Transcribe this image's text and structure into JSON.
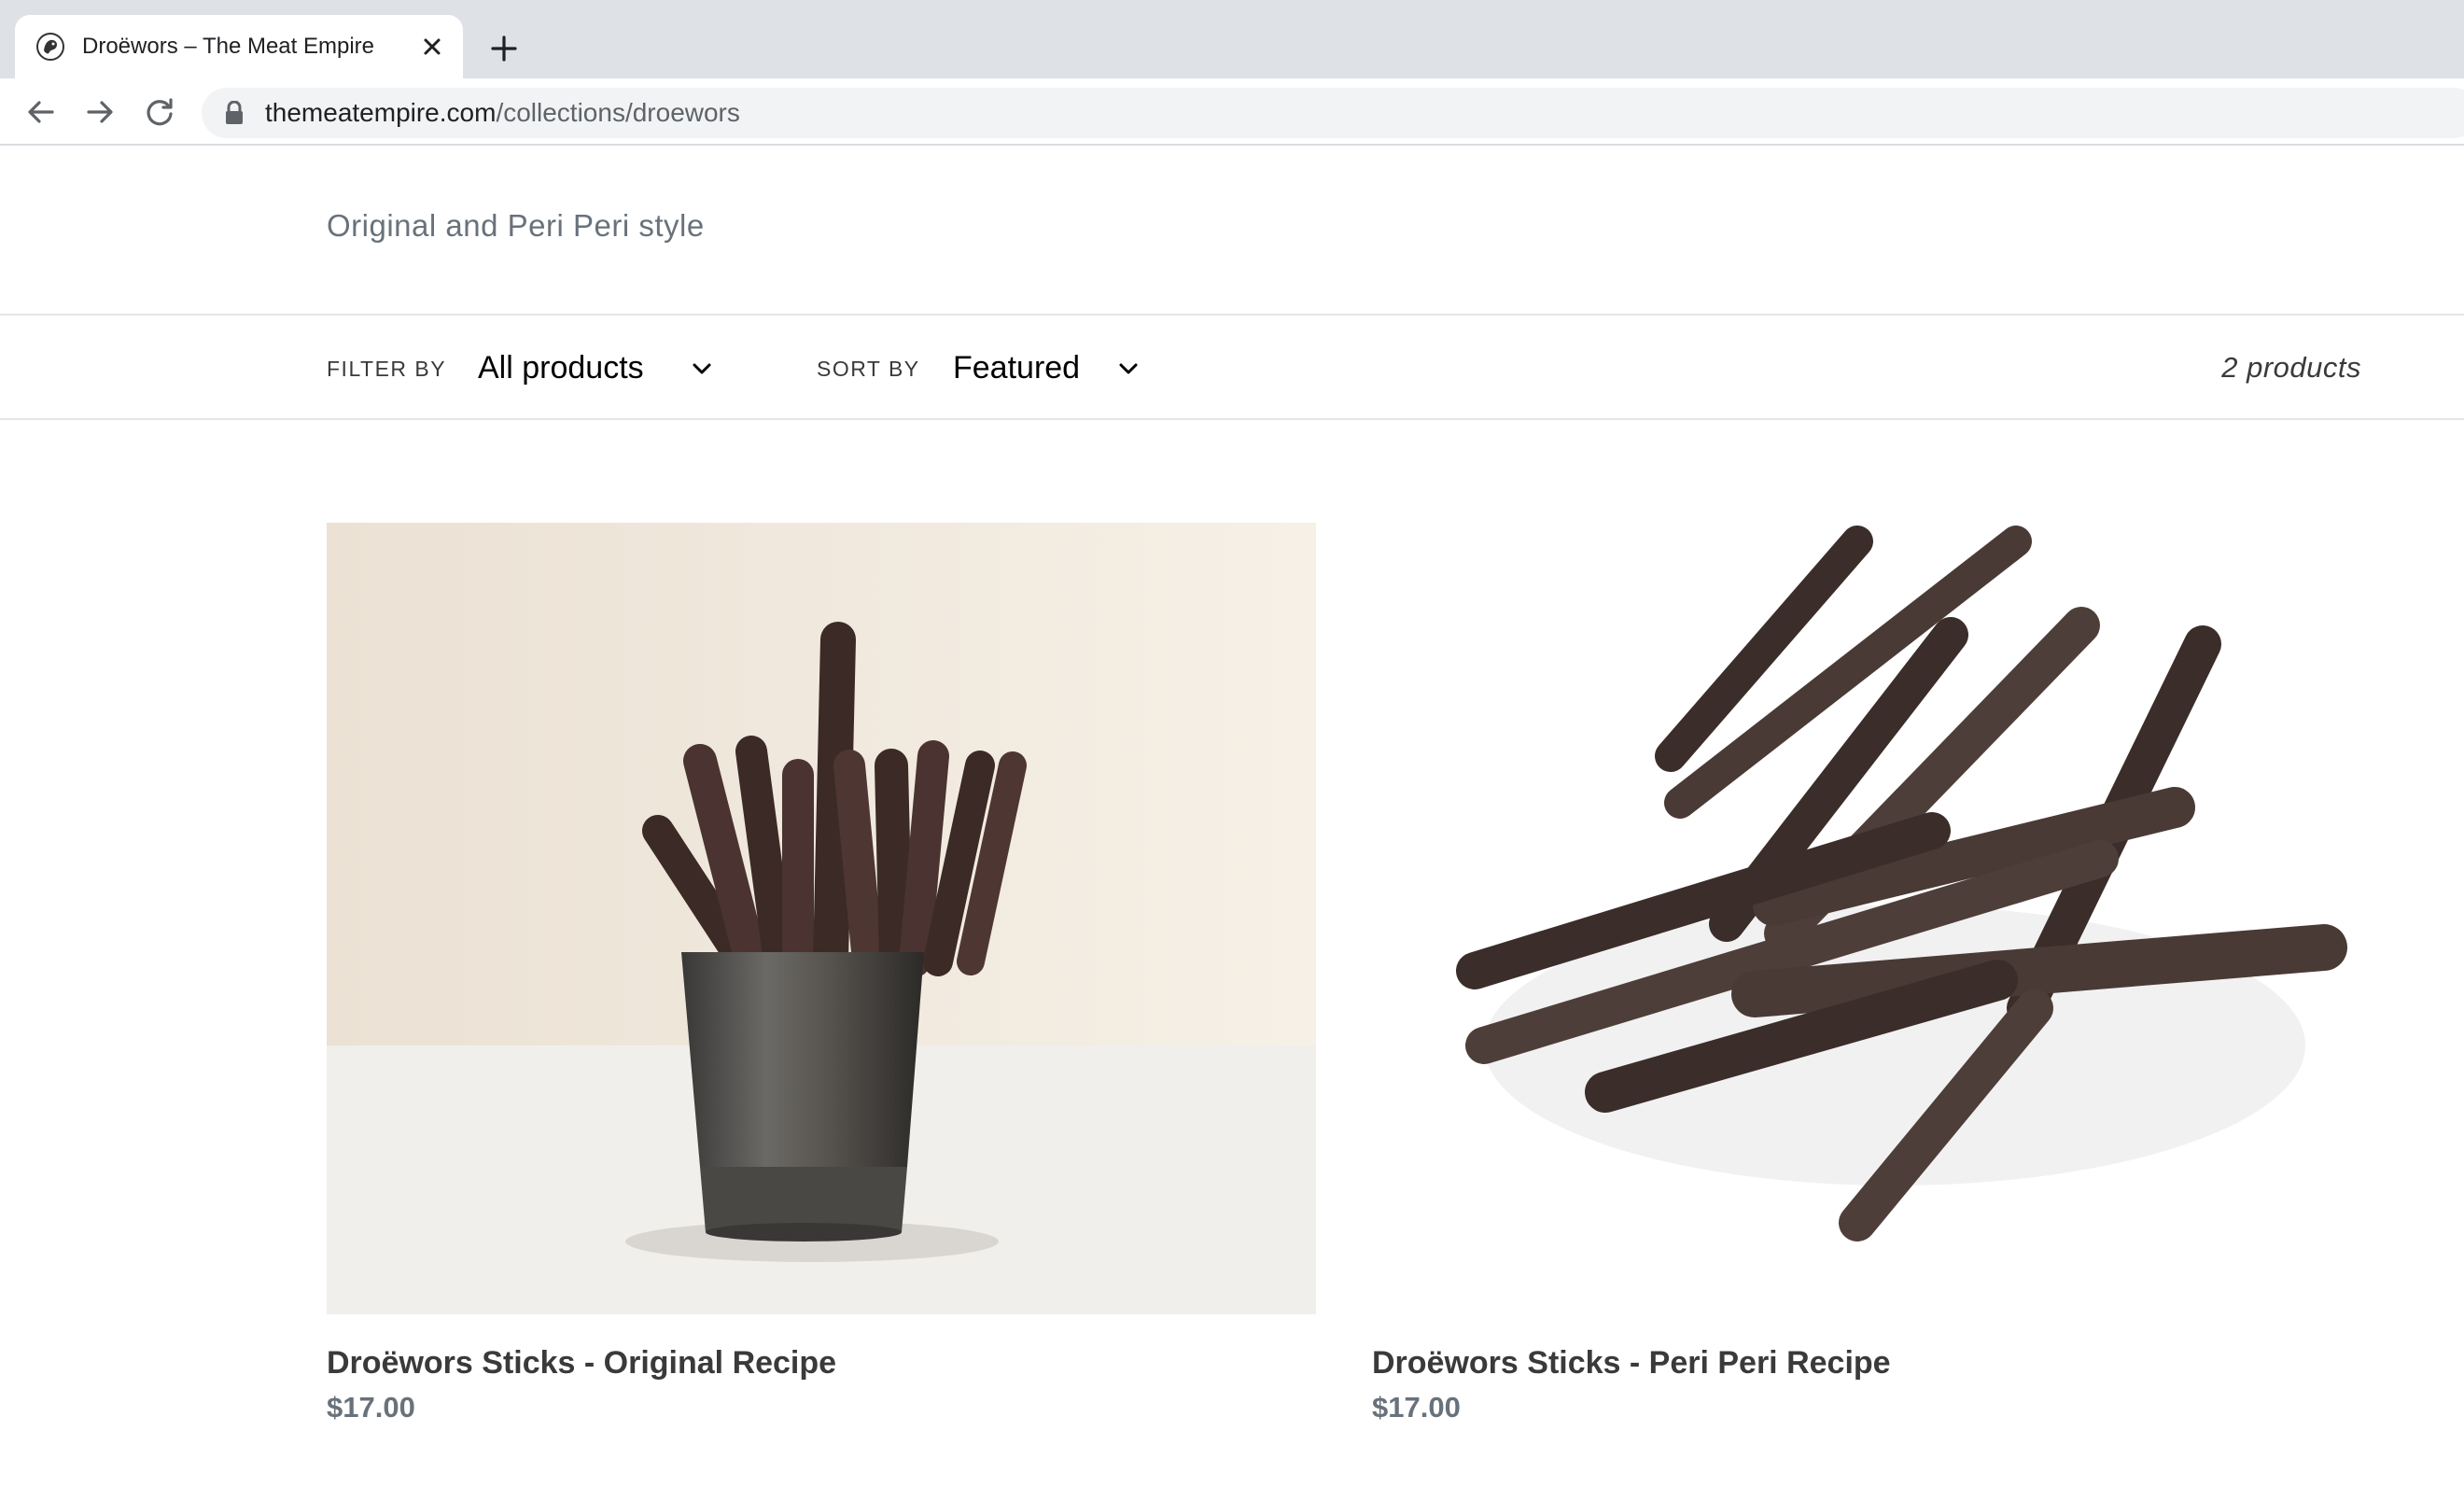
{
  "browser": {
    "tab": {
      "title": "Droëwors – The Meat Empire",
      "favicon": "meat-empire-favicon"
    },
    "url": {
      "host": "themeatempire.com",
      "path": "/collections/droewors"
    },
    "icons": [
      "back-arrow-icon",
      "forward-arrow-icon",
      "reload-icon",
      "lock-icon",
      "close-icon",
      "plus-icon"
    ]
  },
  "collection": {
    "subtitle": "Original and Peri Peri style",
    "filter": {
      "label": "FILTER BY",
      "value": "All products"
    },
    "sort": {
      "label": "SORT BY",
      "value": "Featured"
    },
    "count": "2 products"
  },
  "products": [
    {
      "name": "Droëwors Sticks - Original Recipe",
      "price": "$17.00"
    },
    {
      "name": "Droëwors Sticks - Peri Peri Recipe",
      "price": "$17.00"
    }
  ],
  "colors": {
    "chrome_bg": "#dee1e6",
    "omnibox_bg": "#f1f3f4",
    "text": "#3a3a3a",
    "muted": "#69727b",
    "meat": "#3b2a26"
  }
}
